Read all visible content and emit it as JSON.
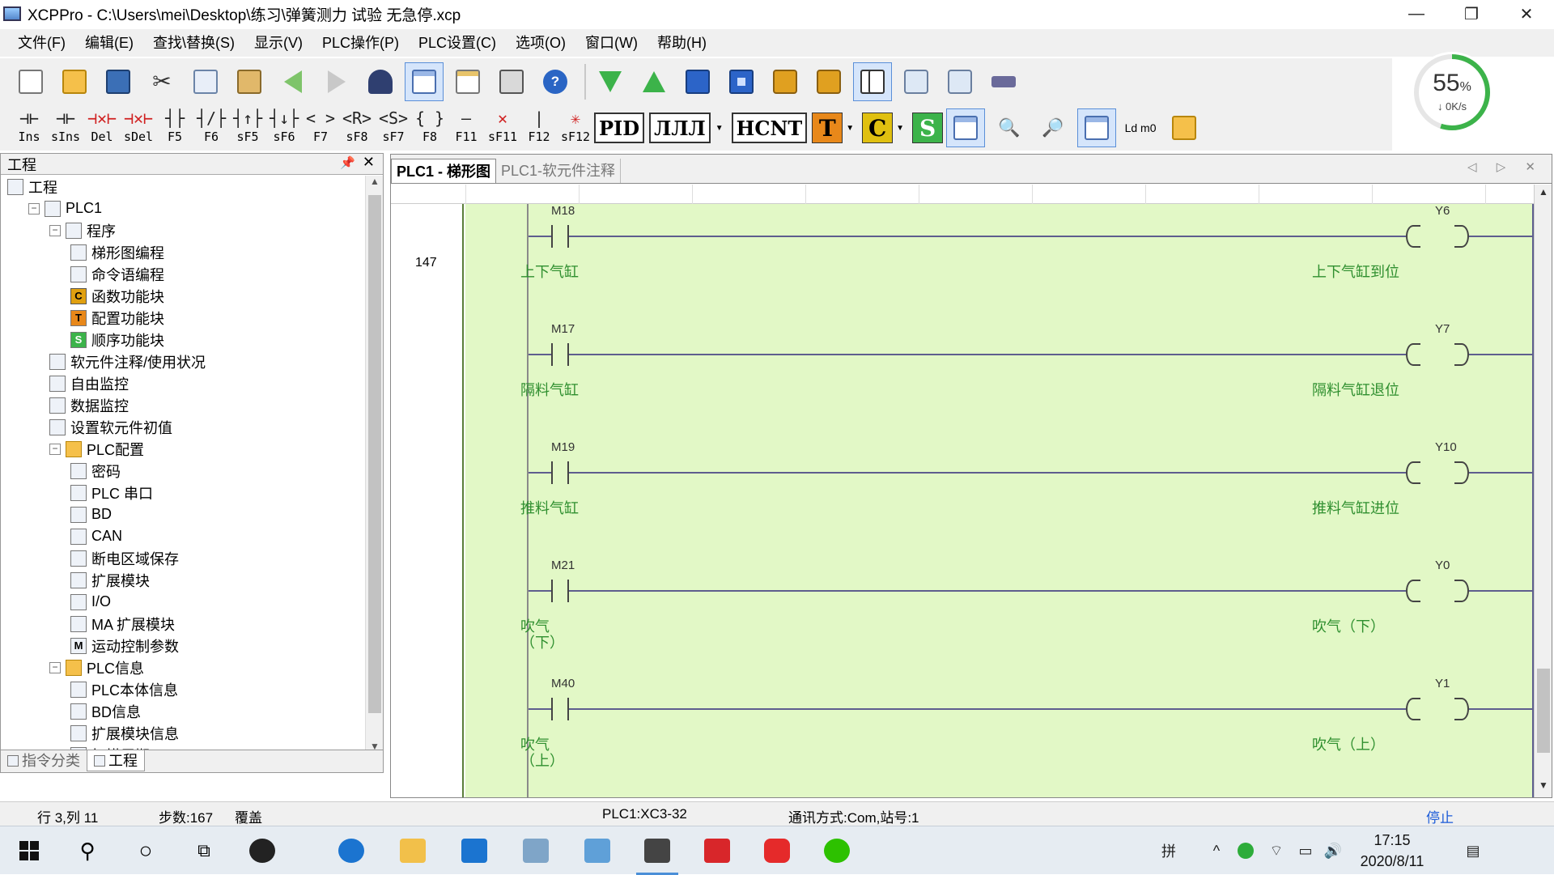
{
  "window": {
    "title": "XCPPro - C:\\Users\\mei\\Desktop\\练习\\弹簧测力 试验 无急停.xcp",
    "min": "—",
    "max": "❐",
    "close": "✕"
  },
  "menu": [
    "文件(F)",
    "编辑(E)",
    "查找\\替换(S)",
    "显示(V)",
    "PLC操作(P)",
    "PLC设置(C)",
    "选项(O)",
    "窗口(W)",
    "帮助(H)"
  ],
  "ladder_toolbar": [
    {
      "sym": "⊣⊢",
      "label": "Ins"
    },
    {
      "sym": "⊣⊢",
      "label": "sIns"
    },
    {
      "sym": "⊣✕⊢",
      "label": "Del",
      "red": true
    },
    {
      "sym": "⊣✕⊢",
      "label": "sDel",
      "red": true
    },
    {
      "sym": "┤├",
      "label": "F5"
    },
    {
      "sym": "┤/├",
      "label": "F6"
    },
    {
      "sym": "┤↑├",
      "label": "sF5"
    },
    {
      "sym": "┤↓├",
      "label": "sF6"
    },
    {
      "sym": "< >",
      "label": "F7"
    },
    {
      "sym": "<R>",
      "label": "sF8"
    },
    {
      "sym": "<S>",
      "label": "sF7"
    },
    {
      "sym": "{ }",
      "label": "F8"
    },
    {
      "sym": "—",
      "label": "F11"
    },
    {
      "sym": "✕",
      "label": "sF11",
      "red": true
    },
    {
      "sym": "|",
      "label": "F12"
    },
    {
      "sym": "✳",
      "label": "sF12",
      "red": true
    }
  ],
  "ladder_text_buttons": {
    "pid": "PID",
    "pulse": "ЛЛЛ",
    "hcnt": "HCNT",
    "t": "T",
    "c": "C",
    "s": "S",
    "ldm0": "Ld m0"
  },
  "gauge": {
    "percent": "55",
    "unit": "%",
    "speed": "↓ 0K/s",
    "fill": 0.55
  },
  "left_panel": {
    "title": "工程",
    "pin": "📌",
    "close": "✕",
    "tree": [
      {
        "level": 0,
        "label": "工程",
        "icon": "project-icon"
      },
      {
        "level": 1,
        "label": "PLC1",
        "icon": "plc-icon",
        "exp": "−"
      },
      {
        "level": 2,
        "label": "程序",
        "icon": "program-icon",
        "exp": "−"
      },
      {
        "level": 3,
        "label": "梯形图编程",
        "icon": "ladder-icon"
      },
      {
        "level": 3,
        "label": "命令语编程",
        "icon": "instruction-icon"
      },
      {
        "level": 3,
        "label": "函数功能块",
        "icon": "c-block-icon",
        "letter": "C"
      },
      {
        "level": 3,
        "label": "配置功能块",
        "icon": "t-block-icon",
        "letter": "T"
      },
      {
        "level": 3,
        "label": "顺序功能块",
        "icon": "s-block-icon",
        "letter": "S"
      },
      {
        "level": 2,
        "label": "软元件注释/使用状况",
        "icon": "comment-icon"
      },
      {
        "level": 2,
        "label": "自由监控",
        "icon": "monitor-icon"
      },
      {
        "level": 2,
        "label": "数据监控",
        "icon": "data-monitor-icon"
      },
      {
        "level": 2,
        "label": "设置软元件初值",
        "icon": "init-value-icon"
      },
      {
        "level": 2,
        "label": "PLC配置",
        "icon": "folder-icon",
        "exp": "−"
      },
      {
        "level": 3,
        "label": "密码",
        "icon": "password-icon"
      },
      {
        "level": 3,
        "label": "PLC 串口",
        "icon": "serial-icon"
      },
      {
        "level": 3,
        "label": "BD",
        "icon": "bd-icon"
      },
      {
        "level": 3,
        "label": "CAN",
        "icon": "can-icon"
      },
      {
        "level": 3,
        "label": "断电区域保存",
        "icon": "power-save-icon"
      },
      {
        "level": 3,
        "label": "扩展模块",
        "icon": "expansion-icon"
      },
      {
        "level": 3,
        "label": "I/O",
        "icon": "io-icon"
      },
      {
        "level": 3,
        "label": "MA 扩展模块",
        "icon": "ma-expansion-icon"
      },
      {
        "level": 3,
        "label": "运动控制参数",
        "icon": "motion-icon",
        "letter": "M"
      },
      {
        "level": 2,
        "label": "PLC信息",
        "icon": "folder-icon",
        "exp": "−"
      },
      {
        "level": 3,
        "label": "PLC本体信息",
        "icon": "info-icon"
      },
      {
        "level": 3,
        "label": "BD信息",
        "icon": "bd-info-icon"
      },
      {
        "level": 3,
        "label": "扩展模块信息",
        "icon": "expansion-info-icon"
      },
      {
        "level": 3,
        "label": "扫描周期",
        "icon": "scan-cycle-icon"
      }
    ],
    "tabs": [
      "指令分类",
      "工程"
    ]
  },
  "editor": {
    "tabs": [
      "PLC1 - 梯形图",
      "PLC1-软元件注释"
    ],
    "nav": "◁ ▷ ✕",
    "step": "147",
    "rungs": [
      {
        "contact": "M18",
        "contact_comment": "上下气缸",
        "coil": "Y6",
        "coil_comment": "上下气缸到位"
      },
      {
        "contact": "M17",
        "contact_comment": "隔料气缸",
        "coil": "Y7",
        "coil_comment": "隔料气缸退位"
      },
      {
        "contact": "M19",
        "contact_comment": "推料气缸",
        "coil": "Y10",
        "coil_comment": "推料气缸进位"
      },
      {
        "contact": "M21",
        "contact_comment": "吹气\n（下）",
        "coil": "Y0",
        "coil_comment": "吹气（下）"
      },
      {
        "contact": "M40",
        "contact_comment": "吹气\n（上）",
        "coil": "Y1",
        "coil_comment": "吹气（上）"
      }
    ]
  },
  "status": {
    "position": "行 3,列 11",
    "steps": "步数:167",
    "mode": "覆盖",
    "plc": "PLC1:XC3-32",
    "comm": "通讯方式:Com,站号:1",
    "run_state": "停止"
  },
  "taskbar": {
    "ime": "拼",
    "time": "17:15",
    "date": "2020/8/11",
    "tray_up": "^",
    "volume": "🔊"
  },
  "colors": {
    "ladder_bg": "#e2f8c6",
    "comment": "#2f8f2f",
    "status_stop": "#1a5ad8",
    "gauge": "#3cb34a"
  }
}
